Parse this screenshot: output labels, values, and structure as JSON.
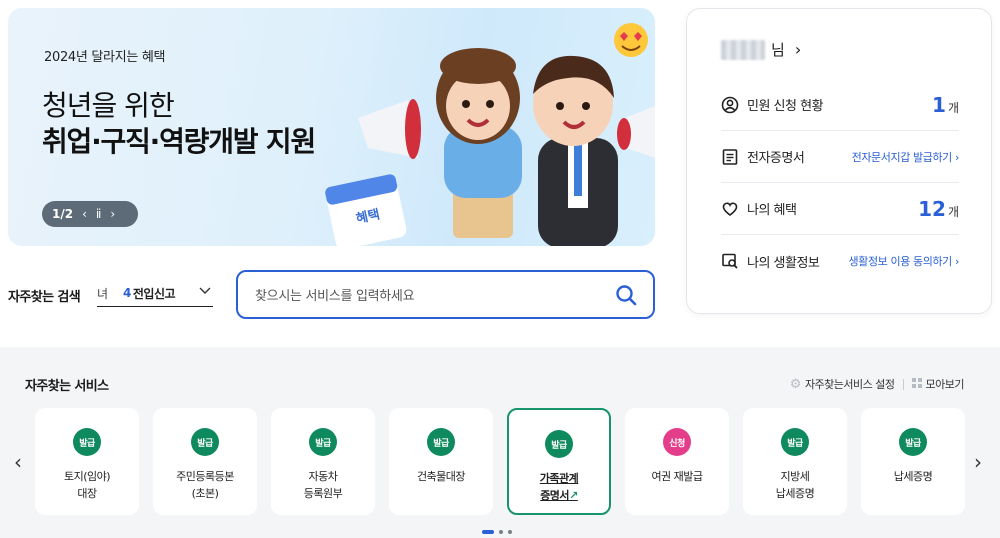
{
  "banner": {
    "subtitle": "2024년 달라지는 혜택",
    "title_line1": "청년을 위한",
    "title_line2": "취업·구직·역량개발 지원",
    "calendar_text": "혜택",
    "page_indicator": "1/2",
    "prev_icon": "chevron-left-icon",
    "pause_icon": "pause-icon",
    "next_icon": "chevron-right-icon"
  },
  "profile": {
    "name_suffix": "님",
    "items": [
      {
        "label": "민원 신청 현황",
        "icon": "user-circle-icon",
        "count": "1",
        "unit": "개"
      },
      {
        "label": "전자증명서",
        "icon": "document-icon",
        "link": "전자문서지갑 발급하기 ›"
      },
      {
        "label": "나의 혜택",
        "icon": "heart-icon",
        "count": "12",
        "unit": "개"
      },
      {
        "label": "나의 생활정보",
        "icon": "search-doc-icon",
        "link": "생활정보 이용 동의하기 ›"
      }
    ]
  },
  "search": {
    "frequent_label": "자주찾는 검색",
    "rank_cut": "녀",
    "rank_number": "4",
    "rank_word": "전입신고",
    "placeholder": "찾으시는 서비스를 입력하세요"
  },
  "services": {
    "title": "자주찾는 서비스",
    "settings_label": "자주찾는서비스 설정",
    "gather_label": "모아보기",
    "cards": [
      {
        "badge": "발급",
        "name": "토지(임야)\n대장"
      },
      {
        "badge": "발급",
        "name": "주민등록등본\n(초본)"
      },
      {
        "badge": "발급",
        "name": "자동차\n등록원부"
      },
      {
        "badge": "발급",
        "name": "건축물대장"
      },
      {
        "badge": "발급",
        "name": "가족관계\n증명서"
      },
      {
        "badge": "신청",
        "name": "여권 재발급"
      },
      {
        "badge": "발급",
        "name": "지방세\n납세증명"
      },
      {
        "badge": "발급",
        "name": "납세증명"
      }
    ]
  },
  "colors": {
    "accent": "#2a5fd6",
    "green": "#0f8a5f",
    "pink": "#e43e8a"
  }
}
